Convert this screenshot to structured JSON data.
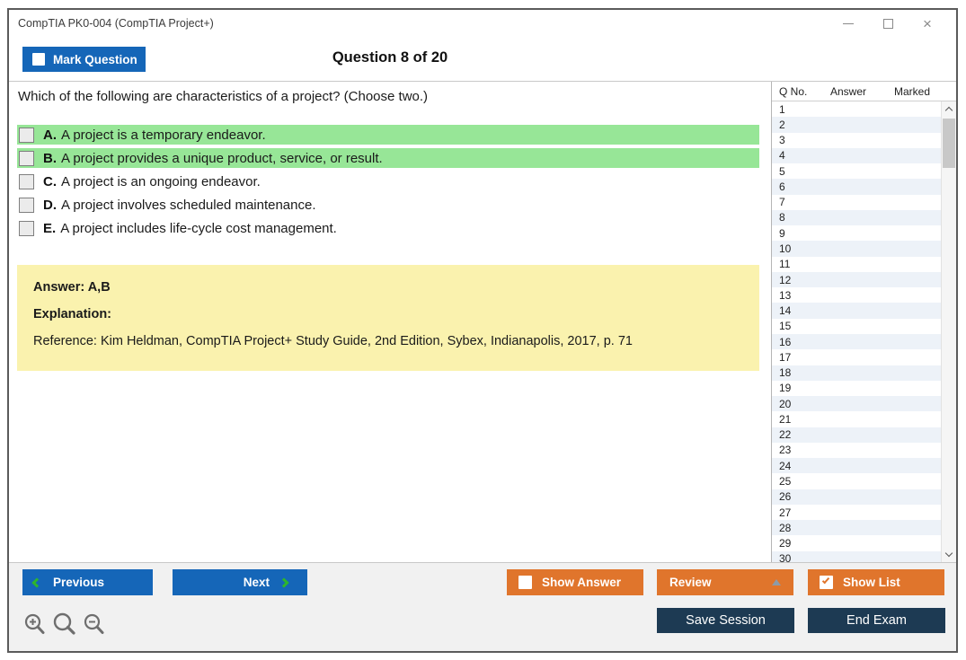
{
  "window": {
    "title": "CompTIA PK0-004 (CompTIA Project+)"
  },
  "header": {
    "mark_question_label": "Mark Question",
    "mark_question_checked": false,
    "question_counter": "Question 8 of 20"
  },
  "question": {
    "text": "Which of the following are characteristics of a project? (Choose two.)",
    "options": [
      {
        "letter": "A.",
        "text": "A project is a temporary endeavor.",
        "highlighted": true
      },
      {
        "letter": "B.",
        "text": "A project provides a unique product, service, or result.",
        "highlighted": true
      },
      {
        "letter": "C.",
        "text": "A project is an ongoing endeavor.",
        "highlighted": false
      },
      {
        "letter": "D.",
        "text": "A project involves scheduled maintenance.",
        "highlighted": false
      },
      {
        "letter": "E.",
        "text": "A project includes life-cycle cost management.",
        "highlighted": false
      }
    ]
  },
  "explanation_box": {
    "answer_label": "Answer: A,B",
    "explanation_label": "Explanation:",
    "reference_text": "Reference: Kim Heldman, CompTIA Project+ Study Guide, 2nd Edition, Sybex, Indianapolis, 2017, p. 71"
  },
  "question_list": {
    "headers": {
      "qno": "Q No.",
      "answer": "Answer",
      "marked": "Marked"
    },
    "rows": [
      1,
      2,
      3,
      4,
      5,
      6,
      7,
      8,
      9,
      10,
      11,
      12,
      13,
      14,
      15,
      16,
      17,
      18,
      19,
      20,
      21,
      22,
      23,
      24,
      25,
      26,
      27,
      28,
      29,
      30
    ]
  },
  "footer": {
    "previous_label": "Previous",
    "next_label": "Next",
    "show_answer_label": "Show Answer",
    "show_answer_checked": false,
    "review_label": "Review",
    "show_list_label": "Show List",
    "show_list_checked": true,
    "save_session_label": "Save Session",
    "end_exam_label": "End Exam"
  },
  "colors": {
    "primary_blue": "#1566b8",
    "accent_orange": "#e0752c",
    "dark_navy": "#1d3a53",
    "highlight_green": "#97e697",
    "explanation_yellow": "#faf2ae",
    "alt_row_blue": "#edf2f8",
    "chevron_green": "#2eb52e"
  }
}
